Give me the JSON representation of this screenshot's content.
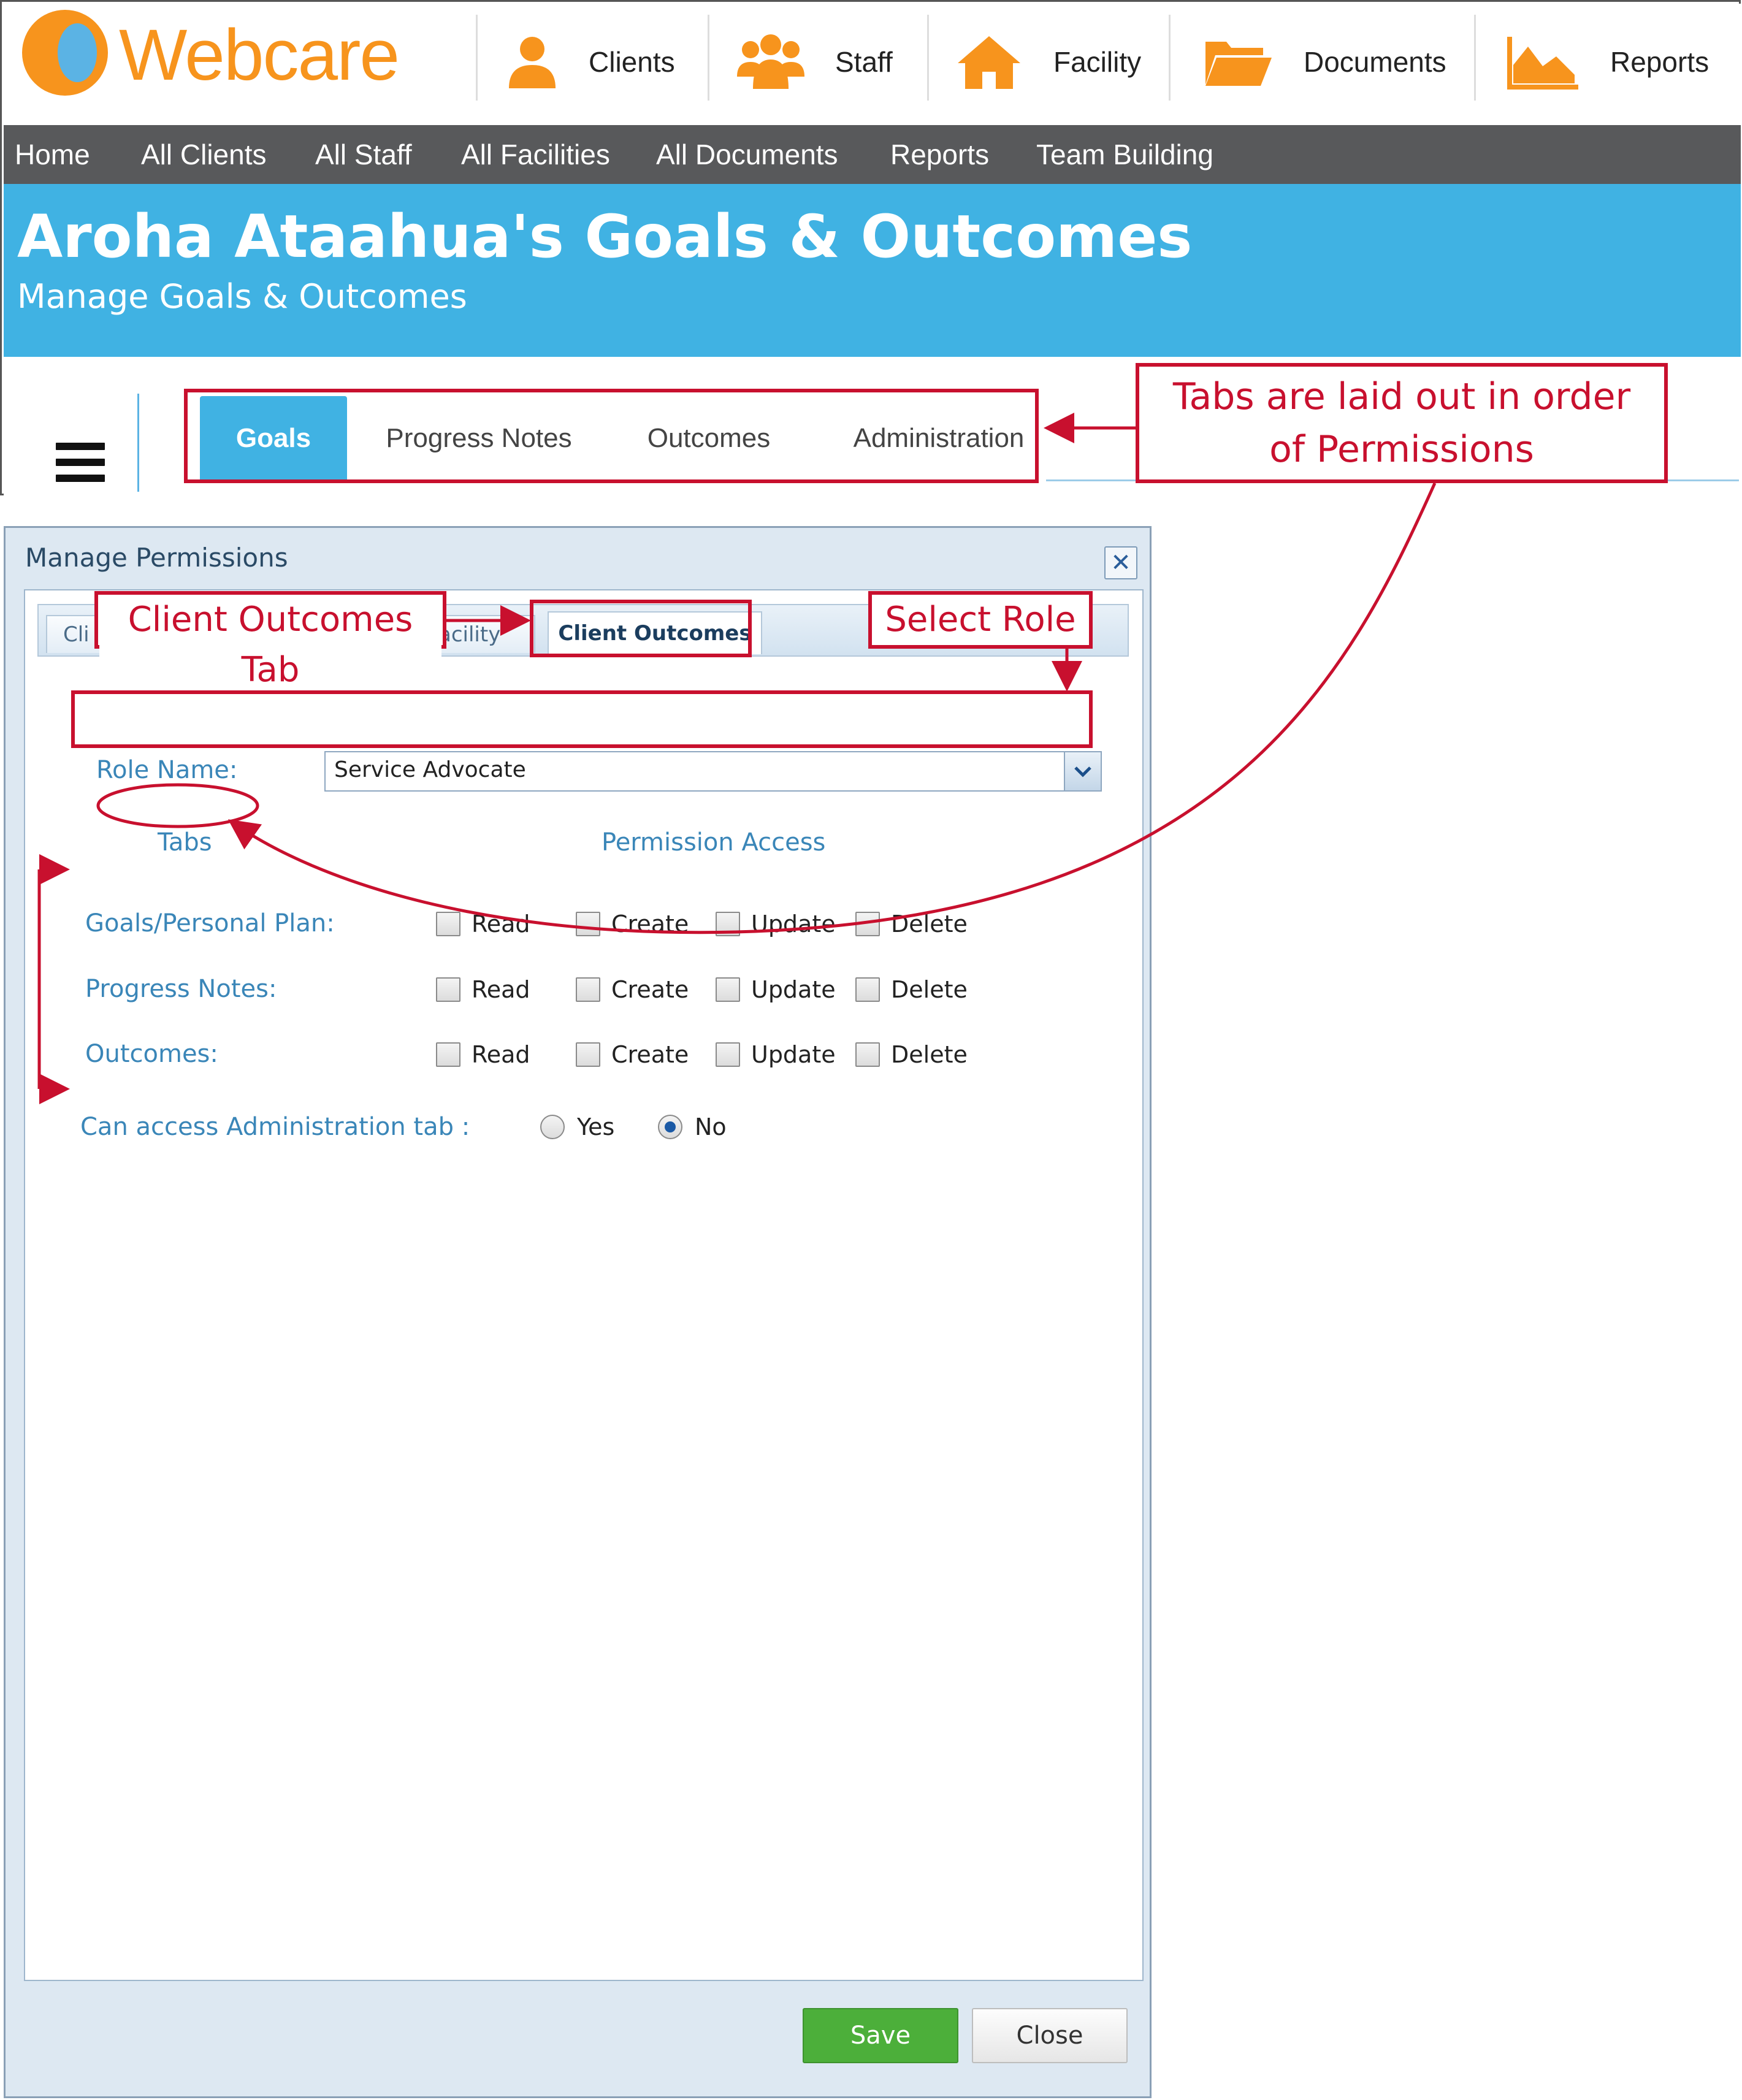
{
  "app": {
    "logo_text": "Webcare",
    "top_nav": [
      {
        "label": "Clients",
        "icon": "person-icon"
      },
      {
        "label": "Staff",
        "icon": "group-icon"
      },
      {
        "label": "Facility",
        "icon": "home-icon"
      },
      {
        "label": "Documents",
        "icon": "folder-icon"
      },
      {
        "label": "Reports",
        "icon": "chart-icon"
      }
    ],
    "menu": [
      "Home",
      "All Clients",
      "All Staff",
      "All Facilities",
      "All Documents",
      "Reports",
      "Team Building"
    ],
    "page_title": "Aroha Ataahua's Goals & Outcomes",
    "page_subtitle": "Manage Goals & Outcomes",
    "tabs": [
      "Goals",
      "Progress Notes",
      "Outcomes",
      "Administration"
    ],
    "active_tab": "Goals"
  },
  "dialog": {
    "title": "Manage Permissions",
    "tabs": [
      "Cli",
      "acility",
      "Client Outcomes"
    ],
    "role_label": "Role Name:",
    "role_value": "Service Advocate",
    "col_tabs": "Tabs",
    "col_access": "Permission Access",
    "rows": [
      {
        "label": "Goals/Personal Plan:",
        "perms": [
          "Read",
          "Create",
          "Update",
          "Delete"
        ]
      },
      {
        "label": "Progress Notes:",
        "perms": [
          "Read",
          "Create",
          "Update",
          "Delete"
        ]
      },
      {
        "label": "Outcomes:",
        "perms": [
          "Read",
          "Create",
          "Update",
          "Delete"
        ]
      }
    ],
    "admin_label": "Can access Administration tab :",
    "admin_options": [
      "Yes",
      "No"
    ],
    "admin_selected": "No",
    "save_label": "Save",
    "close_label": "Close"
  },
  "annotations": {
    "tabs_order_line1": "Tabs are laid out in order",
    "tabs_order_line2": "of Permissions",
    "client_outcomes_tab": "Client Outcomes Tab",
    "select_role": "Select Role"
  },
  "colors": {
    "brand_orange": "#f7941d",
    "brand_blue": "#40b2e3",
    "menu_bg": "#58595b",
    "annotation_red": "#c8102e",
    "save_green": "#4caf3a"
  }
}
